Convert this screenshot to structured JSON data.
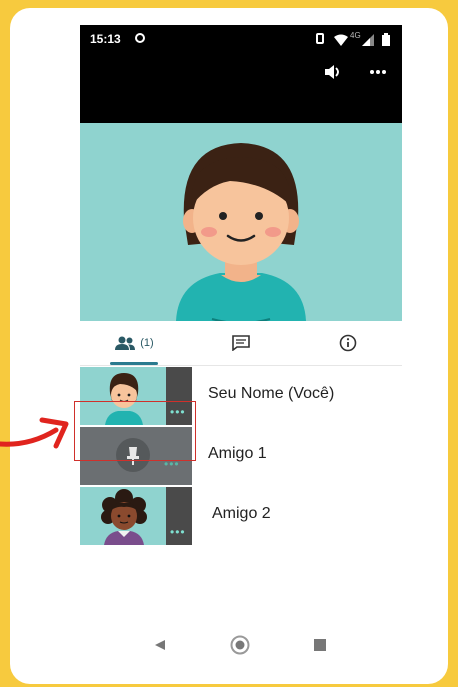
{
  "status_bar": {
    "time": "15:13",
    "right_icons": [
      "vibrate-icon",
      "wifi-icon",
      "signal-4g-icon",
      "battery-icon"
    ],
    "network_label": "4G"
  },
  "top_bar": {
    "speaker_icon": "speaker-icon",
    "more_icon": "more-horizontal-icon"
  },
  "tabs": [
    {
      "name": "participants",
      "icon": "people-icon",
      "label": "(1)",
      "selected": true
    },
    {
      "name": "chat",
      "icon": "chat-icon",
      "label": ""
    },
    {
      "name": "info",
      "icon": "info-icon",
      "label": ""
    }
  ],
  "participants": [
    {
      "name": "Seu Nome (Você)",
      "avatar": "girl-avatar",
      "video": true
    },
    {
      "name": "Amigo 1",
      "avatar": "mic-off-placeholder",
      "video": false,
      "highlighted": true
    },
    {
      "name": "Amigo 2",
      "avatar": "curly-hair-avatar",
      "video": true
    }
  ],
  "nav_bar": {
    "back_icon": "back-triangle-icon",
    "home_icon": "home-circle-icon",
    "recents_icon": "recents-square-icon"
  },
  "colors": {
    "page_bg": "#f7ca3e",
    "video_bg": "#8fd3cf",
    "highlight_border": "#d0302b",
    "arrow": "#e0241e",
    "accent": "#2a7b8f"
  }
}
